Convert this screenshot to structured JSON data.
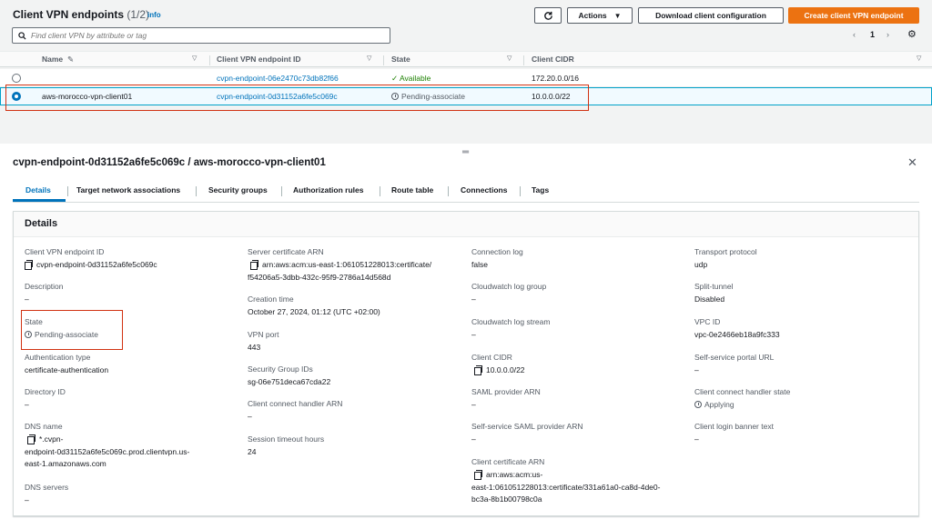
{
  "list": {
    "title": "Client VPN endpoints",
    "count": "(1/2)",
    "info": "info",
    "buttons": {
      "actions": "Actions",
      "download": "Download client configuration",
      "create": "Create client VPN endpoint"
    },
    "search_placeholder": "Find client VPN by attribute or tag",
    "page": "1",
    "columns": [
      "Name",
      "Client VPN endpoint ID",
      "State",
      "Client CIDR"
    ],
    "rows": [
      {
        "name": "",
        "id": "cvpn-endpoint-06e2470c73db82f66",
        "state": "Available",
        "cidr": "172.20.0.0/16",
        "selected": false
      },
      {
        "name": "aws-morocco-vpn-client01",
        "id": "cvpn-endpoint-0d31152a6fe5c069c",
        "state": "Pending-associate",
        "cidr": "10.0.0.0/22",
        "selected": true
      }
    ]
  },
  "detail": {
    "title": "cvpn-endpoint-0d31152a6fe5c069c / aws-morocco-vpn-client01",
    "tabs": [
      "Details",
      "Target network associations",
      "Security groups",
      "Authorization rules",
      "Route table",
      "Connections",
      "Tags"
    ],
    "active_tab": "Details",
    "section_title": "Details",
    "fields": {
      "endpoint_id": {
        "label": "Client VPN endpoint ID",
        "value": "cvpn-endpoint-0d31152a6fe5c069c"
      },
      "description": {
        "label": "Description",
        "value": "–"
      },
      "state": {
        "label": "State",
        "value": "Pending-associate"
      },
      "auth_type": {
        "label": "Authentication type",
        "value": "certificate-authentication"
      },
      "directory_id": {
        "label": "Directory ID",
        "value": "–"
      },
      "dns_name": {
        "label": "DNS name",
        "value_lines": [
          "*.cvpn-",
          "endpoint-0d31152a6fe5c069c.prod.clientvpn.us-",
          "east-1.amazonaws.com"
        ]
      },
      "dns_servers": {
        "label": "DNS servers",
        "value": "–"
      },
      "server_cert": {
        "label": "Server certificate ARN",
        "value_lines": [
          "arn:aws:acm:us-east-1:061051228013:certificate/",
          "f54206a5-3dbb-432c-95f9-2786a14d568d"
        ]
      },
      "creation_time": {
        "label": "Creation time",
        "value": "October 27, 2024, 01:12 (UTC +02:00)"
      },
      "vpn_port": {
        "label": "VPN port",
        "value": "443"
      },
      "sg_ids": {
        "label": "Security Group IDs",
        "value": "sg-06e751deca67cda22"
      },
      "connect_handler_arn": {
        "label": "Client connect handler ARN",
        "value": "–"
      },
      "session_timeout": {
        "label": "Session timeout hours",
        "value": "24"
      },
      "connection_log": {
        "label": "Connection log",
        "value": "false"
      },
      "cw_log_group": {
        "label": "Cloudwatch log group",
        "value": "–"
      },
      "cw_log_stream": {
        "label": "Cloudwatch log stream",
        "value": "–"
      },
      "client_cidr": {
        "label": "Client CIDR",
        "value": "10.0.0.0/22"
      },
      "saml_provider": {
        "label": "SAML provider ARN",
        "value": "–"
      },
      "ss_saml_provider": {
        "label": "Self-service SAML provider ARN",
        "value": "–"
      },
      "client_cert": {
        "label": "Client certificate ARN",
        "value_lines": [
          "arn:aws:acm:us-",
          "east-1:061051228013:certificate/331a61a0-ca8d-4de0-",
          "bc3a-8b1b00798c0a"
        ]
      },
      "transport": {
        "label": "Transport protocol",
        "value": "udp"
      },
      "split_tunnel": {
        "label": "Split-tunnel",
        "value": "Disabled"
      },
      "vpc_id": {
        "label": "VPC ID",
        "value": "vpc-0e2466eb18a9fc333"
      },
      "portal_url": {
        "label": "Self-service portal URL",
        "value": "–"
      },
      "handler_state": {
        "label": "Client connect handler state",
        "value": "Applying"
      },
      "banner": {
        "label": "Client login banner text",
        "value": "–"
      }
    }
  },
  "colors": {
    "primary": "#ec7211",
    "link": "#0073bb",
    "success": "#1d8102",
    "highlight": "#d13212"
  }
}
